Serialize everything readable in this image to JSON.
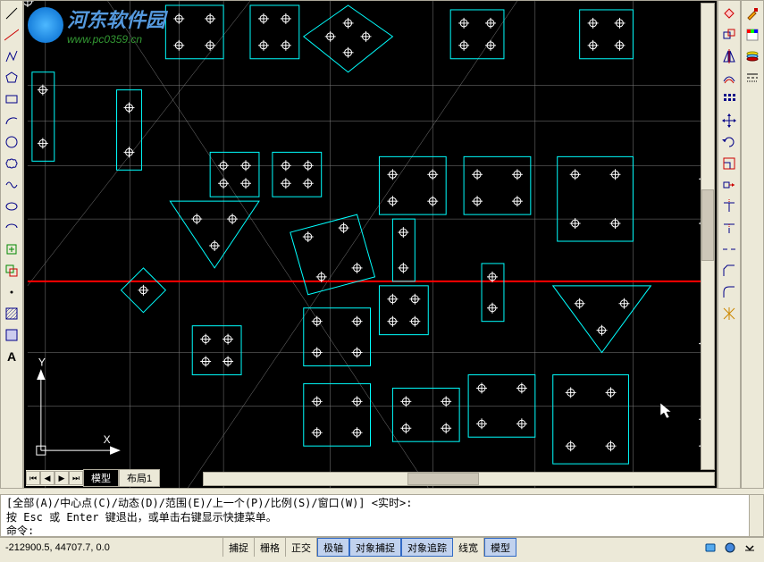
{
  "watermark": {
    "title": "河东软件园",
    "url": "www.pc0359.cn"
  },
  "tabs": {
    "model": "模型",
    "layout1": "布局1"
  },
  "command": {
    "line1": "[全部(A)/中心点(C)/动态(D)/范围(E)/上一个(P)/比例(S)/窗口(W)] <实时>:",
    "line2": "按 Esc 或 Enter 键退出，或单击右键显示快捷菜单。",
    "prompt": "命令:"
  },
  "status": {
    "coordinates": "-212900.5, 44707.7, 0.0",
    "snap": "捕捉",
    "grid": "栅格",
    "ortho": "正交",
    "polar": "极轴",
    "osnap": "对象捕捉",
    "otrack": "对象追踪",
    "lineweight": "线宽",
    "model": "模型"
  },
  "ucs": {
    "y_label": "Y",
    "x_label": "X"
  }
}
